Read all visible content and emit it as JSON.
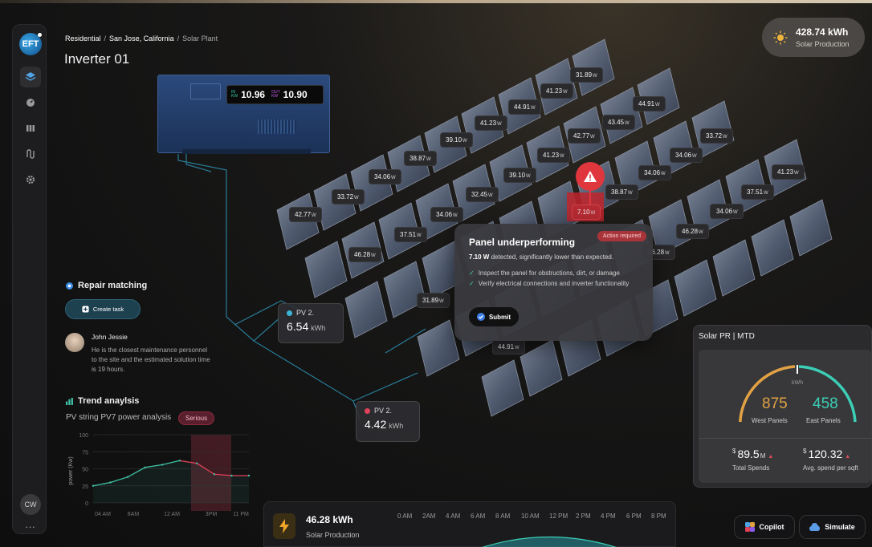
{
  "breadcrumb": {
    "level1": "Residential",
    "sep": "/",
    "level2": "San Jose, California",
    "level3": "Solar Plant"
  },
  "page_title": "Inverter 01",
  "logo_text": "EFT",
  "user_initials": "CW",
  "more_label": "...",
  "header_production": {
    "value": "428.74 kWh",
    "label": "Solar Production"
  },
  "inverter": {
    "in_label_1": "IN",
    "in_label_2": "KW",
    "in_value": "10.96",
    "out_label_1": "OUT",
    "out_label_2": "KW",
    "out_value": "10.90"
  },
  "panels": [
    {
      "value": "31.89",
      "unit": "W"
    },
    {
      "value": "41.23",
      "unit": "W"
    },
    {
      "value": "44.91",
      "unit": "W"
    },
    {
      "value": "41.23",
      "unit": "W"
    },
    {
      "value": "44.91",
      "unit": "W"
    },
    {
      "value": "43.45",
      "unit": "W"
    },
    {
      "value": "39.10",
      "unit": "W"
    },
    {
      "value": "42.77",
      "unit": "W"
    },
    {
      "value": "38.87",
      "unit": "W"
    },
    {
      "value": "41.23",
      "unit": "W"
    },
    {
      "value": "33.72",
      "unit": "W"
    },
    {
      "value": "34.06",
      "unit": "W"
    },
    {
      "value": "34.06",
      "unit": "W"
    },
    {
      "value": "39.10",
      "unit": "W"
    },
    {
      "value": "34.06",
      "unit": "W"
    },
    {
      "value": "33.72",
      "unit": "W"
    },
    {
      "value": "32.45",
      "unit": "W"
    },
    {
      "value": "38.87",
      "unit": "W"
    },
    {
      "value": "41.23",
      "unit": "W"
    },
    {
      "value": "42.77",
      "unit": "W"
    },
    {
      "value": "37.51",
      "unit": "W"
    },
    {
      "value": "34.06",
      "unit": "W"
    },
    {
      "value": "37.51",
      "unit": "W"
    },
    {
      "value": "46.28",
      "unit": "W"
    },
    {
      "value": "46.28",
      "unit": "W"
    },
    {
      "value": "26.28",
      "unit": "W"
    },
    {
      "value": "31.89",
      "unit": "W"
    },
    {
      "value": "44.91",
      "unit": "W"
    }
  ],
  "faulty_panel": {
    "value": "7.10",
    "unit": "W"
  },
  "popup": {
    "title": "Panel underperforming",
    "badge": "Action required",
    "desc_value": "7.10 W",
    "desc_text": " detected, significantly lower than expected.",
    "items": [
      "Inspect the panel for obstructions, dirt, or damage",
      "Verify electrical connections and inverter functionality"
    ],
    "submit": "Submit"
  },
  "pv_strings": [
    {
      "name": "PV 2.",
      "value": "6.54",
      "unit": "kWh",
      "color": "#3bb5d6"
    },
    {
      "name": "PV 2.",
      "value": "4.42",
      "unit": "kWh",
      "color": "#e0405a"
    }
  ],
  "repair": {
    "title": "Repair matching",
    "create_task": "Create task",
    "person_name": "John Jessie",
    "person_desc": "He is the closest maintenance personnel to the site and the estimated solution time is 19 hours."
  },
  "trend": {
    "title": "Trend anaylsis",
    "subtitle": "PV string PV7 power analysis",
    "badge": "Serious",
    "chart_data": {
      "type": "line",
      "ylabel": "power (Kw)",
      "xlabel": "",
      "ylim": [
        0,
        100
      ],
      "y_ticks": [
        "100",
        "75",
        "50",
        "25",
        "0"
      ],
      "x_ticks": [
        "04 AM",
        "8AM",
        "12 AM",
        "3PM",
        "11 PM"
      ],
      "series": [
        {
          "values": [
            25,
            30,
            38,
            52,
            56,
            62,
            58,
            42,
            40,
            40
          ],
          "color": "#3fc2a6"
        }
      ]
    }
  },
  "solar_pr": {
    "title": "Solar PR | MTD",
    "unit": "kWh",
    "west_value": "875",
    "west_label": "West Panels",
    "east_value": "458",
    "east_label": "East Panels",
    "total_spends": {
      "currency": "$",
      "value": "89.5",
      "suffix": "M",
      "trend": "▲",
      "label": "Total Spends"
    },
    "avg_spend": {
      "currency": "$",
      "value": "120.32",
      "trend": "▲",
      "label": "Avg. spend per sqft"
    }
  },
  "bottom": {
    "value": "46.28 kWh",
    "label": "Solar Production",
    "hours": [
      "0 AM",
      "2AM",
      "4 AM",
      "6 AM",
      "8 AM",
      "10 AM",
      "12 PM",
      "2 PM",
      "4 PM",
      "6 PM",
      "8 PM"
    ]
  },
  "actions": {
    "copilot": "Copilot",
    "simulate": "Simulate"
  },
  "colors": {
    "accent_teal": "#3bd6a0",
    "alert_red": "#e0363d",
    "west_orange": "#e2a244",
    "east_teal": "#3ccfb5"
  }
}
